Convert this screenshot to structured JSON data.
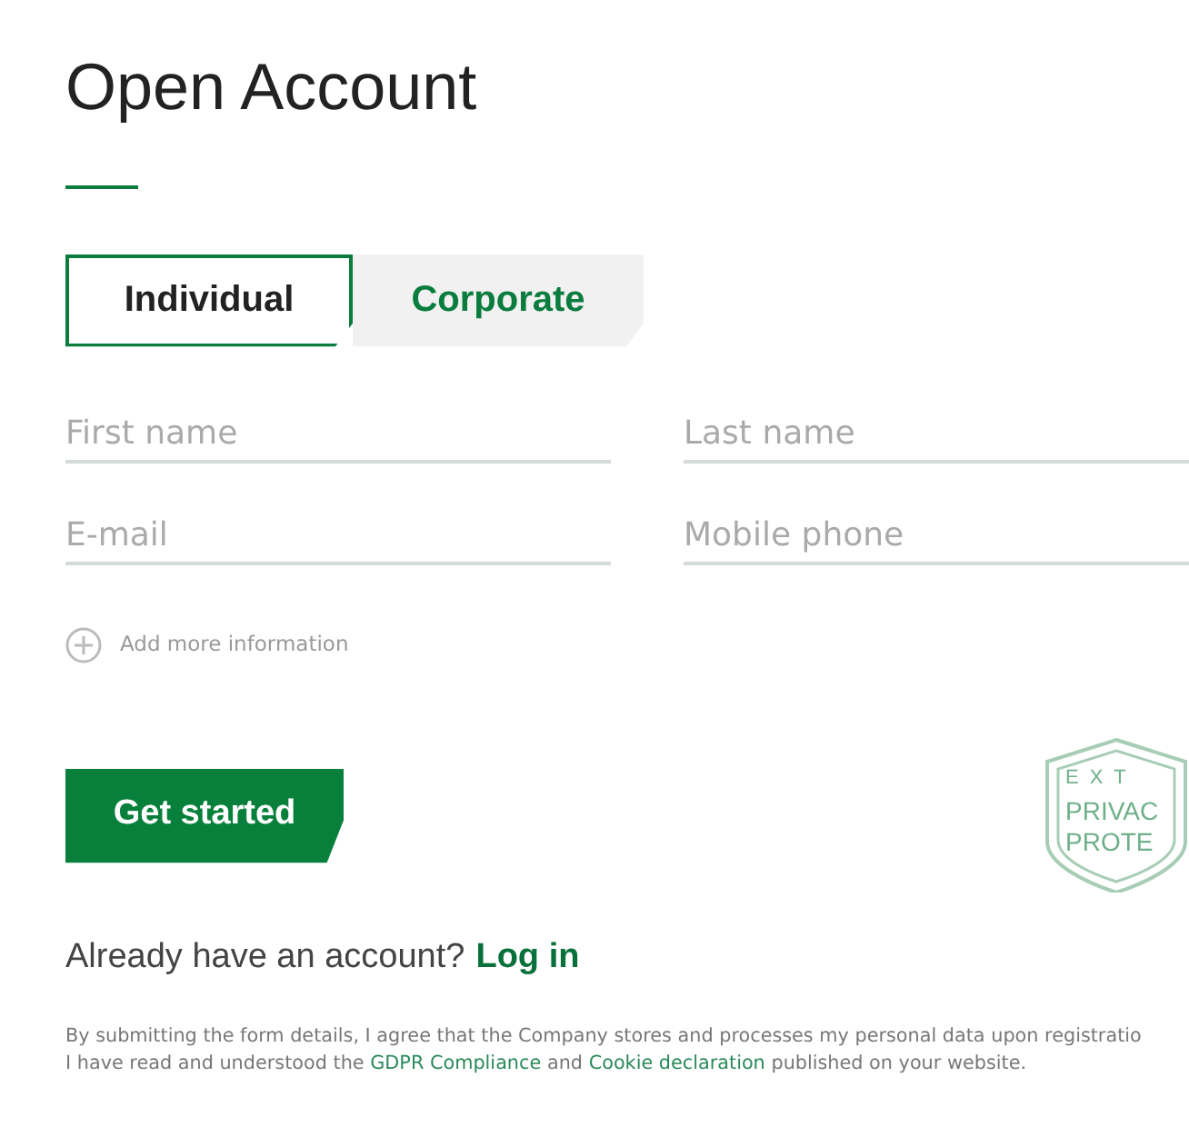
{
  "title": "Open Account",
  "tabs": [
    {
      "label": "Individual",
      "selected": true
    },
    {
      "label": "Corporate",
      "selected": false
    }
  ],
  "fields": [
    {
      "placeholder": "First name"
    },
    {
      "placeholder": "Last name"
    },
    {
      "placeholder": "E-mail"
    },
    {
      "placeholder": "Mobile phone"
    }
  ],
  "add_more": {
    "label": "Add more information"
  },
  "submit": {
    "label": "Get started"
  },
  "badge": {
    "lines": [
      "EXT",
      "PRIVAC",
      "PROTE"
    ]
  },
  "login": {
    "prompt": "Already have an account?",
    "link": "Log in"
  },
  "consent": {
    "parts": [
      {
        "kind": "text",
        "text": "By submitting the form details, I agree that the Company stores and processes my personal data upon registratio"
      },
      {
        "kind": "break"
      },
      {
        "kind": "text",
        "text": "I have read and understood the"
      },
      {
        "kind": "link",
        "text": "GDPR Compliance"
      },
      {
        "kind": "text",
        "text": "and"
      },
      {
        "kind": "link",
        "text": "Cookie declaration"
      },
      {
        "kind": "text",
        "text": "published on your website."
      }
    ]
  }
}
